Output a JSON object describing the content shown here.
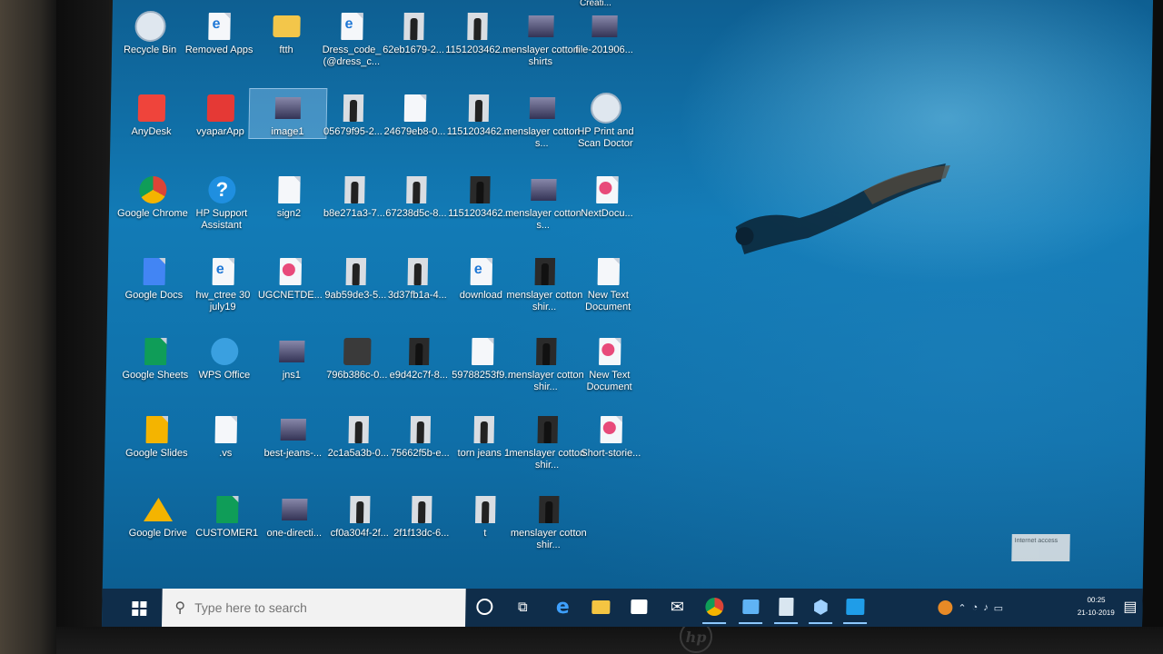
{
  "desktop": {
    "icons": [
      {
        "label": "Recycle Bin"
      },
      {
        "label": "Removed Apps"
      },
      {
        "label": "ftth"
      },
      {
        "label": "Dress_code_ (@dress_c..."
      },
      {
        "label": "62eb1679-2..."
      },
      {
        "label": "1151203462..."
      },
      {
        "label": "menslayer cotton shirts"
      },
      {
        "label": "file-201906..."
      },
      {
        "label": "AnyDesk"
      },
      {
        "label": "vyaparApp"
      },
      {
        "label": "image1"
      },
      {
        "label": "05679f95-2..."
      },
      {
        "label": "24679eb8-0..."
      },
      {
        "label": "1151203462..."
      },
      {
        "label": "menslayer cotton s..."
      },
      {
        "label": "HP Print and Scan Doctor"
      },
      {
        "label": "Google Chrome"
      },
      {
        "label": "HP Support Assistant"
      },
      {
        "label": "sign2"
      },
      {
        "label": "b8e271a3-7..."
      },
      {
        "label": "67238d5c-8..."
      },
      {
        "label": "1151203462..."
      },
      {
        "label": "menslayer cotton s..."
      },
      {
        "label": "NextDocu..."
      },
      {
        "label": "Google Docs"
      },
      {
        "label": "hw_ctree 30 july19"
      },
      {
        "label": "UGCNETDE..."
      },
      {
        "label": "9ab59de3-5..."
      },
      {
        "label": "3d37fb1a-4..."
      },
      {
        "label": "download"
      },
      {
        "label": "menslayer cotton shir..."
      },
      {
        "label": "New Text Document"
      },
      {
        "label": "Google Sheets"
      },
      {
        "label": "WPS Office"
      },
      {
        "label": "jns1"
      },
      {
        "label": "796b386c-0..."
      },
      {
        "label": "e9d42c7f-8..."
      },
      {
        "label": "59788253f9..."
      },
      {
        "label": "menslayer cotton shir..."
      },
      {
        "label": "New Text Document"
      },
      {
        "label": "Google Slides"
      },
      {
        "label": ".vs"
      },
      {
        "label": "best-jeans-..."
      },
      {
        "label": "2c1a5a3b-0..."
      },
      {
        "label": "75662f5b-e..."
      },
      {
        "label": "torn jeans 1"
      },
      {
        "label": "menslayer cotton shir..."
      },
      {
        "label": "Short-storie..."
      },
      {
        "label": "Google Drive"
      },
      {
        "label": "CUSTOMER1"
      },
      {
        "label": "one-directi..."
      },
      {
        "label": "cf0a304f-2f..."
      },
      {
        "label": "2f1f13dc-6..."
      },
      {
        "label": "t"
      },
      {
        "label": "menslayer cotton shir..."
      }
    ],
    "top_cut_label": "Creati..."
  },
  "taskbar": {
    "search_placeholder": "Type here to search",
    "clock_time": "00:25",
    "clock_date": "21-10-2019",
    "tooltip": "Internet access"
  },
  "colors": {
    "taskbar": "#0f2d4a",
    "accent": "#8cc8ff",
    "desktop": "#127bb6"
  }
}
